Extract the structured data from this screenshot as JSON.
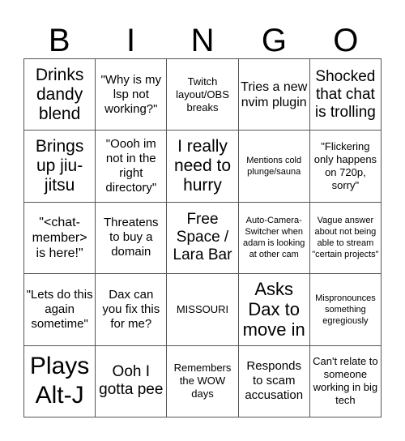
{
  "header": {
    "letters": [
      "B",
      "I",
      "N",
      "G",
      "O"
    ]
  },
  "cells": [
    "Drinks dandy blend",
    "\"Why is my lsp not working?\"",
    "Twitch layout/OBS breaks",
    "Tries a new nvim plugin",
    "Shocked that chat is trolling",
    "Brings up jiu-jitsu",
    "\"Oooh im not in the right directory\"",
    "I really need to hurry",
    "Mentions cold plunge/sauna",
    "\"Flickering only happens on 720p, sorry\"",
    "\"<chat-member> is here!\"",
    "Threatens to buy a domain",
    "Free Space / Lara Bar",
    "Auto-Camera-Switcher when adam is looking at other cam",
    "Vague answer about not being able to stream \"certain projects\"",
    "\"Lets do this again sometime\"",
    "Dax can you fix this for me?",
    "MISSOURI",
    "Asks Dax to move in",
    "Mispronounces something egregiously",
    "Plays Alt-J",
    "Ooh I gotta pee",
    "Remembers the WOW days",
    "Responds to scam accusation",
    "Can't relate to someone working in big tech"
  ]
}
